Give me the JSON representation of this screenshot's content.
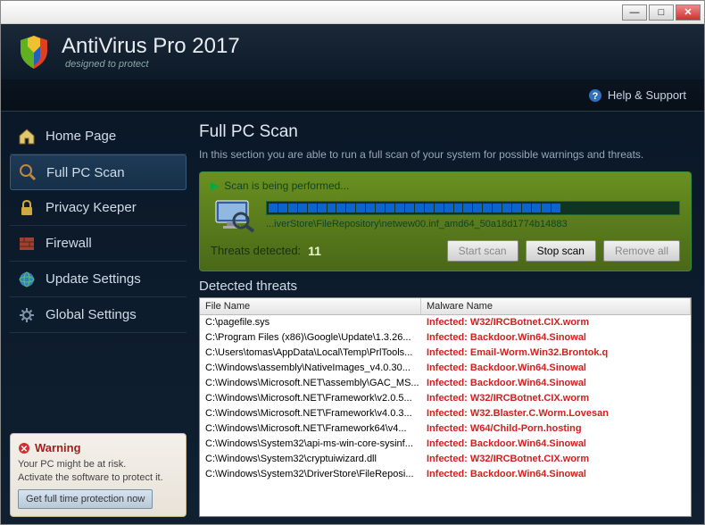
{
  "app": {
    "title": "AntiVirus Pro 2017",
    "subtitle": "designed to protect"
  },
  "help_link": "Help & Support",
  "sidebar": {
    "items": [
      {
        "label": "Home Page",
        "icon": "home-icon"
      },
      {
        "label": "Full PC Scan",
        "icon": "search-icon"
      },
      {
        "label": "Privacy Keeper",
        "icon": "lock-icon"
      },
      {
        "label": "Firewall",
        "icon": "firewall-icon"
      },
      {
        "label": "Update Settings",
        "icon": "globe-icon"
      },
      {
        "label": "Global Settings",
        "icon": "gear-icon"
      }
    ],
    "selected_index": 1
  },
  "warning": {
    "title": "Warning",
    "text": "Your PC might be at risk.\nActivate the software to protect it.",
    "button": "Get full time protection now"
  },
  "main": {
    "title": "Full PC Scan",
    "description": "In this section you are able to run a full scan of your system for possible warnings and threats."
  },
  "scan": {
    "status": "Scan is being performed...",
    "current_path": "...iverStore\\FileRepository\\netwew00.inf_amd64_50a18d1774b14883",
    "threats_label": "Threats detected:",
    "threats_count": "11",
    "progress_segments": 42,
    "progress_filled": 30,
    "buttons": {
      "start": "Start scan",
      "stop": "Stop scan",
      "remove": "Remove all"
    }
  },
  "threats": {
    "section_title": "Detected threats",
    "columns": {
      "file": "File Name",
      "malware": "Malware Name"
    },
    "rows": [
      {
        "file": "C:\\pagefile.sys",
        "malware": "Infected: W32/IRCBotnet.CIX.worm"
      },
      {
        "file": "C:\\Program Files (x86)\\Google\\Update\\1.3.26...",
        "malware": "Infected: Backdoor.Win64.Sinowal"
      },
      {
        "file": "C:\\Users\\tomas\\AppData\\Local\\Temp\\PrlTools...",
        "malware": "Infected: Email-Worm.Win32.Brontok.q"
      },
      {
        "file": "C:\\Windows\\assembly\\NativeImages_v4.0.30...",
        "malware": "Infected: Backdoor.Win64.Sinowal"
      },
      {
        "file": "C:\\Windows\\Microsoft.NET\\assembly\\GAC_MS...",
        "malware": "Infected: Backdoor.Win64.Sinowal"
      },
      {
        "file": "C:\\Windows\\Microsoft.NET\\Framework\\v2.0.5...",
        "malware": "Infected: W32/IRCBotnet.CIX.worm"
      },
      {
        "file": "C:\\Windows\\Microsoft.NET\\Framework\\v4.0.3...",
        "malware": "Infected: W32.Blaster.C.Worm.Lovesan"
      },
      {
        "file": "C:\\Windows\\Microsoft.NET\\Framework64\\v4...",
        "malware": "Infected: W64/Child-Porn.hosting"
      },
      {
        "file": "C:\\Windows\\System32\\api-ms-win-core-sysinf...",
        "malware": "Infected: Backdoor.Win64.Sinowal"
      },
      {
        "file": "C:\\Windows\\System32\\cryptuiwizard.dll",
        "malware": "Infected: W32/IRCBotnet.CIX.worm"
      },
      {
        "file": "C:\\Windows\\System32\\DriverStore\\FileReposi...",
        "malware": "Infected: Backdoor.Win64.Sinowal"
      }
    ]
  }
}
